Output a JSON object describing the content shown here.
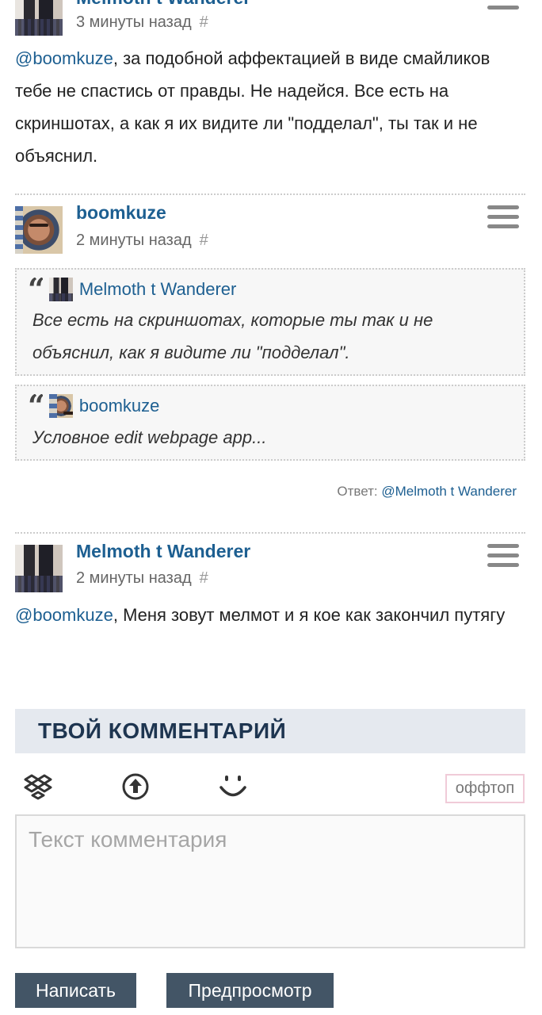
{
  "comments": [
    {
      "author": "Melmoth t Wanderer",
      "time": "3 минуты назад",
      "hash": "#",
      "mention": "@boomkuze",
      "text": ", за подобной аффектацией в виде смайликов тебе не спастись от правды. Не надейся. Все есть на скриншотах, а как я их видите ли \"подделал\", ты так и не объяснил."
    },
    {
      "author": "boomkuze",
      "time": "2 минуты назад",
      "hash": "#",
      "quotes": [
        {
          "author": "Melmoth t Wanderer",
          "text": "Все есть на скриншотах, которые ты так и не объяснил, как я видите ли \"подделал\"."
        },
        {
          "author": "boomkuze",
          "text": "Условное edit webpage app..."
        }
      ],
      "reply_label": "Ответ:",
      "reply_to": "@Melmoth t Wanderer"
    },
    {
      "author": "Melmoth t Wanderer",
      "time": "2 минуты назад",
      "hash": "#",
      "mention": "@boomkuze",
      "text": ", Меня зовут мелмот и я кое как закончил путягу"
    }
  ],
  "form": {
    "title": "ТВОЙ КОММЕНТАРИЙ",
    "offtop": "оффтоп",
    "placeholder": "Текст комментария",
    "submit": "Написать",
    "preview": "Предпросмотр",
    "icons": [
      "dropbox-icon",
      "upload-icon",
      "smiley-icon"
    ]
  },
  "colors": {
    "link": "#1d5f91",
    "button": "#435566",
    "header_bg": "#e5e9ef"
  }
}
